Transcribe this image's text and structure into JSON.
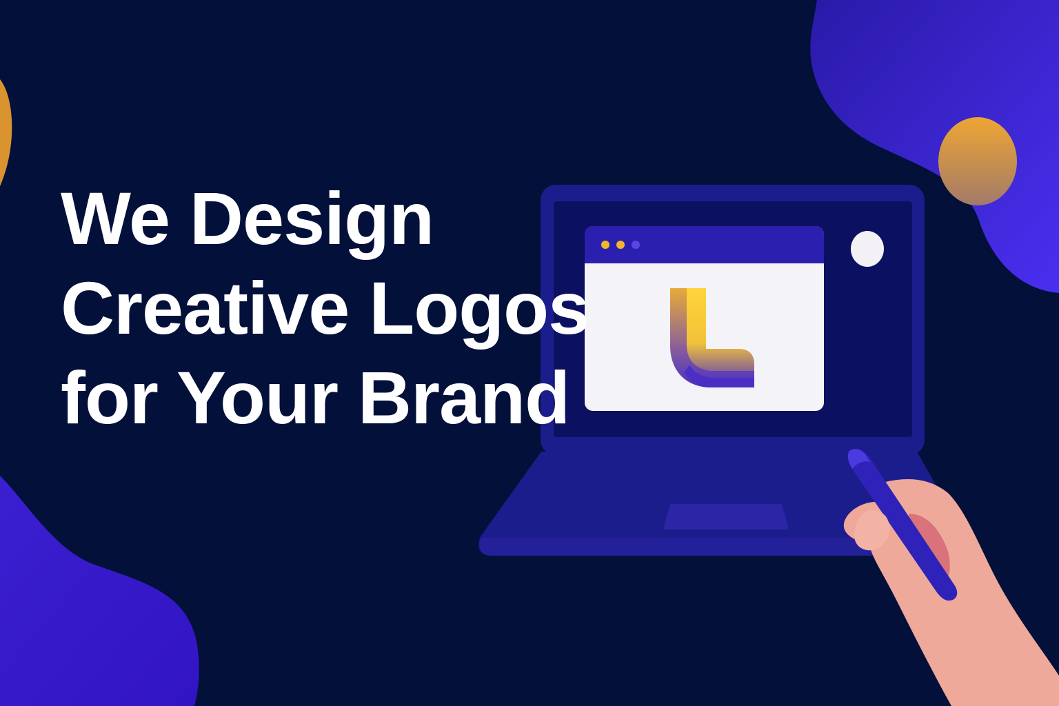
{
  "headline": {
    "line1": "We Design",
    "line2": "Creative Logos",
    "line3": "for Your Brand"
  },
  "colors": {
    "background": "#03103a",
    "blob_purple": "#3b1fd6",
    "accent_gold": "#e6a338",
    "laptop_body": "#1c1d8c",
    "screen": "#0b1160",
    "browser_bar": "#2b1fb0",
    "logo_yellow": "#ffd43b",
    "logo_purple": "#4b2fc4",
    "skin": "#efa99a",
    "pen": "#2f22b8"
  },
  "icons": {
    "logo_mark": "letter-l-logo-icon",
    "window_controls": "window-dots-icon",
    "pen": "stylus-pen-icon"
  }
}
